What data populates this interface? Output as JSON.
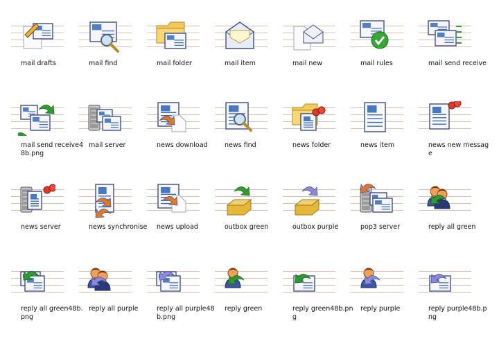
{
  "icons": [
    {
      "label": "mail drafts",
      "icon": "mail-drafts-icon"
    },
    {
      "label": "mail find",
      "icon": "mail-find-icon"
    },
    {
      "label": "mail folder",
      "icon": "mail-folder-icon"
    },
    {
      "label": "mail item",
      "icon": "mail-item-icon"
    },
    {
      "label": "mail new",
      "icon": "mail-new-icon"
    },
    {
      "label": "mail rules",
      "icon": "mail-rules-icon"
    },
    {
      "label": "mail send receive",
      "icon": "mail-send-receive-icon"
    },
    {
      "label": "mail send receive48b.png",
      "icon": "mail-send-receive-48b-icon"
    },
    {
      "label": "mail server",
      "icon": "mail-server-icon"
    },
    {
      "label": "news download",
      "icon": "news-download-icon"
    },
    {
      "label": "news find",
      "icon": "news-find-icon"
    },
    {
      "label": "news folder",
      "icon": "news-folder-icon"
    },
    {
      "label": "news item",
      "icon": "news-item-icon"
    },
    {
      "label": "news new message",
      "icon": "news-new-message-icon"
    },
    {
      "label": "news server",
      "icon": "news-server-icon"
    },
    {
      "label": "news synchronise",
      "icon": "news-synchronise-icon"
    },
    {
      "label": "news upload",
      "icon": "news-upload-icon"
    },
    {
      "label": "outbox green",
      "icon": "outbox-green-icon"
    },
    {
      "label": "outbox purple",
      "icon": "outbox-purple-icon"
    },
    {
      "label": "pop3 server",
      "icon": "pop3-server-icon"
    },
    {
      "label": "reply all green",
      "icon": "reply-all-green-icon"
    },
    {
      "label": "reply all green48b.png",
      "icon": "reply-all-green-48b-icon"
    },
    {
      "label": "reply all purple",
      "icon": "reply-all-purple-icon"
    },
    {
      "label": "reply all purple48b.png",
      "icon": "reply-all-purple-48b-icon"
    },
    {
      "label": "reply green",
      "icon": "reply-green-icon"
    },
    {
      "label": "reply green48b.png",
      "icon": "reply-green-48b-icon"
    },
    {
      "label": "reply purple",
      "icon": "reply-purple-icon"
    },
    {
      "label": "reply purple48b.png",
      "icon": "reply-purple-48b-icon"
    }
  ]
}
